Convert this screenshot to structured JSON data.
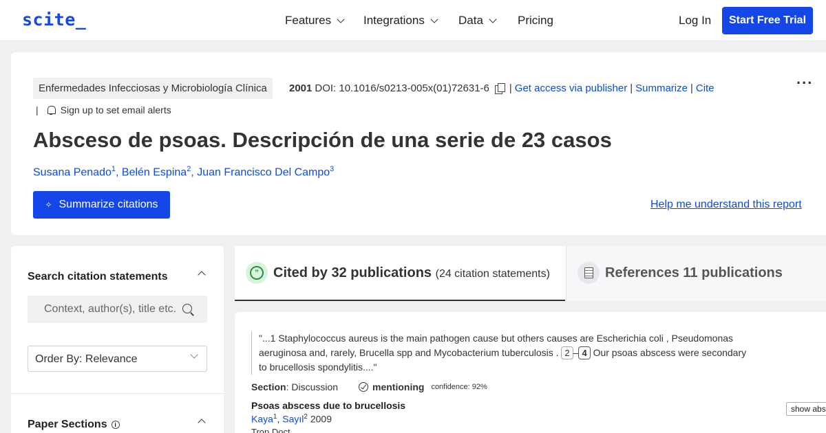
{
  "nav": {
    "logo": "scite_",
    "items": [
      "Features",
      "Integrations",
      "Data",
      "Pricing"
    ],
    "login": "Log In",
    "trial": "Start Free Trial"
  },
  "paper": {
    "journal": "Enfermedades Infecciosas y Microbiología Clínica",
    "year": "2001",
    "doi": "DOI: 10.1016/s0213-005x(01)72631-6",
    "links": [
      "Get access via publisher",
      "Summarize",
      "Cite"
    ],
    "alerts": "Sign up to set email alerts",
    "title": "Absceso de psoas. Descripción de una serie de 23 casos",
    "authors": [
      {
        "name": "Susana Penado",
        "sup": "1"
      },
      {
        "name": "Belén Espina",
        "sup": "2"
      },
      {
        "name": "Juan Francisco Del Campo",
        "sup": "3"
      }
    ],
    "summarize_btn": "Summarize citations",
    "help": "Help me understand this report",
    "more": "..."
  },
  "sidebar": {
    "search_title": "Search citation statements",
    "search_placeholder": "Context, author(s), title etc.",
    "order": "Order By: Relevance",
    "sections_title": "Paper Sections"
  },
  "tabs": {
    "cited_main": "Cited by 32 publications",
    "cited_sub": "(24 citation statements)",
    "refs": "References 11 publications"
  },
  "citation": {
    "quote_a": "\"...1 Staphylococcus aureus is the main pathogen cause but others causes are Escherichia coli , Pseudomonas aeruginosa and, rarely, Brucella spp and Mycobacterium tuberculosis .",
    "ref1": "2",
    "dash": "–",
    "ref2": "4",
    "quote_b": "Our psoas abscess were secondary to brucellosis spondylitis....\"",
    "section_label": "Section",
    "section_value": ": Discussion",
    "type": "mentioning",
    "confidence": "confidence: 92%",
    "pub_title": "Psoas abscess due to brucellosis",
    "pub_authors": [
      {
        "name": "Kaya",
        "sup": "1"
      },
      {
        "name": "Sayıl",
        "sup": "2"
      }
    ],
    "pub_year": "2009",
    "pub_journal": "Trop Doct",
    "show_abstract": "show abstract"
  }
}
